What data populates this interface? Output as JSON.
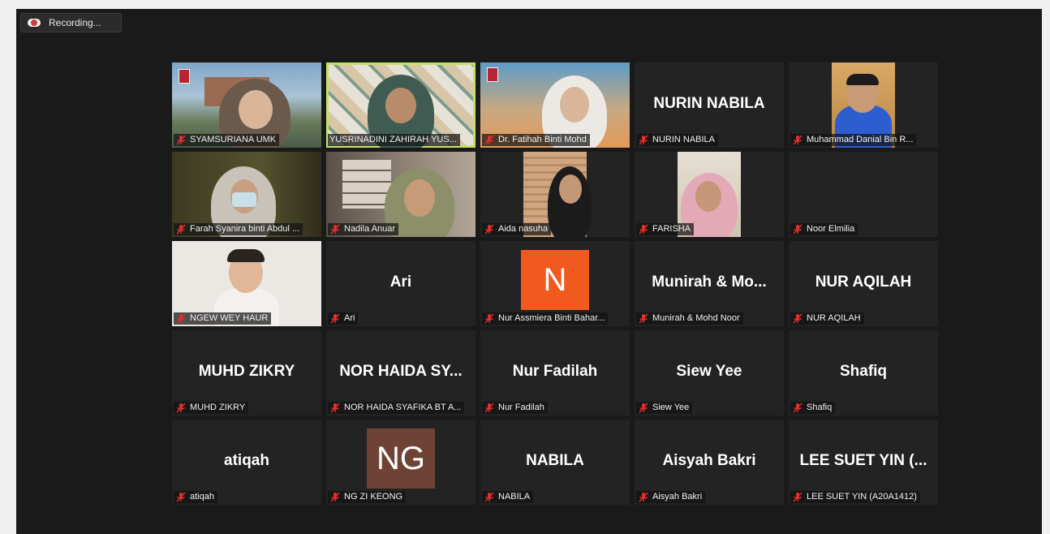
{
  "recording": {
    "label": "Recording..."
  },
  "colors": {
    "background": "#1a1a1a",
    "tile": "#232323",
    "active_speaker": "#c5e26a",
    "muted_mic": "#e0302c",
    "recording_dot": "#d33a3a"
  },
  "participants": [
    {
      "name": "SYAMSURIANA UMK",
      "display": "",
      "video": true
    },
    {
      "name": "YUSRINADINI ZAHIRAH YUS...",
      "display": "",
      "video": true,
      "active": true
    },
    {
      "name": "Dr. Fatihah Binti Mohd",
      "display": "",
      "video": true
    },
    {
      "name": "NURIN NABILA",
      "display": "NURIN NABILA",
      "video": false
    },
    {
      "name": "Muhammad Danial Bin R...",
      "display": "",
      "video": true
    },
    {
      "name": "Farah Syanira binti Abdul ...",
      "display": "",
      "video": true
    },
    {
      "name": "Nadila Anuar",
      "display": "",
      "video": true
    },
    {
      "name": "Aida nasuha",
      "display": "",
      "video": true
    },
    {
      "name": "FARISHA",
      "display": "",
      "video": true
    },
    {
      "name": "Noor Elmilia",
      "display": "",
      "video": false
    },
    {
      "name": "NGEW WEY HAUR",
      "display": "",
      "video": true
    },
    {
      "name": "Ari",
      "display": "Ari",
      "video": false
    },
    {
      "name": "Nur Assmiera Binti Bahar...",
      "display": "",
      "video": false,
      "avatar": "N",
      "avatar_color": "#f05a1e"
    },
    {
      "name": "Munirah & Mohd Noor",
      "display": "Munirah & Mo...",
      "video": false
    },
    {
      "name": "NUR AQILAH",
      "display": "NUR AQILAH",
      "video": false
    },
    {
      "name": "MUHD ZIKRY",
      "display": "MUHD ZIKRY",
      "video": false
    },
    {
      "name": "NOR HAIDA SYAFIKA BT A...",
      "display": "NOR HAIDA SY...",
      "video": false
    },
    {
      "name": "Nur Fadilah",
      "display": "Nur Fadilah",
      "video": false
    },
    {
      "name": "Siew Yee",
      "display": "Siew Yee",
      "video": false
    },
    {
      "name": "Shafiq",
      "display": "Shafiq",
      "video": false
    },
    {
      "name": "atiqah",
      "display": "atiqah",
      "video": false
    },
    {
      "name": "NG ZI KEONG",
      "display": "",
      "video": false,
      "avatar": "NG",
      "avatar_color": "#6e4335"
    },
    {
      "name": "NABILA",
      "display": "NABILA",
      "video": false
    },
    {
      "name": "Aisyah Bakri",
      "display": "Aisyah Bakri",
      "video": false
    },
    {
      "name": "LEE SUET YIN (A20A1412)",
      "display": "LEE SUET YIN (...",
      "video": false
    }
  ]
}
